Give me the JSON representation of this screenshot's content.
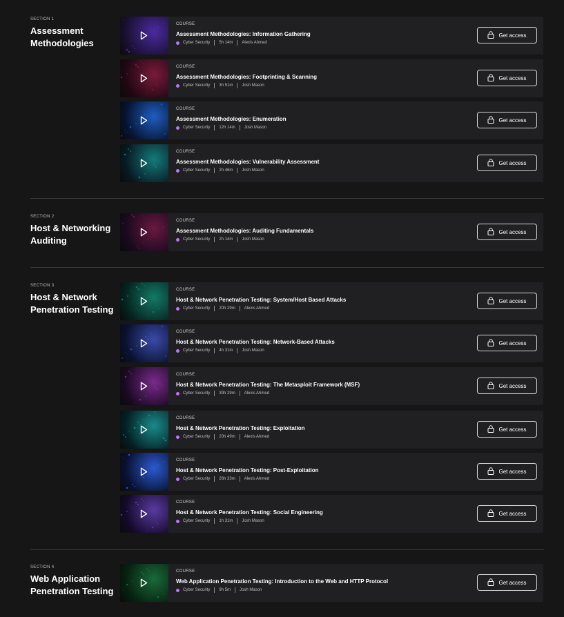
{
  "sections": [
    {
      "label": "SECTION 1",
      "title": "Assessment Methodologies",
      "courses": [
        {
          "kind": "COURSE",
          "title": "Assessment Methodologies: Information Gathering",
          "category": "Cyber Security",
          "duration": "5h 14m",
          "author": "Alexis Ahmed",
          "thumb": [
            "#1a1030",
            "#4a2aa0"
          ]
        },
        {
          "kind": "COURSE",
          "title": "Assessment Methodologies: Footprinting & Scanning",
          "category": "Cyber Security",
          "duration": "3h 51m",
          "author": "Josh Mason",
          "thumb": [
            "#200812",
            "#7a1a3a"
          ]
        },
        {
          "kind": "COURSE",
          "title": "Assessment Methodologies: Enumeration",
          "category": "Cyber Security",
          "duration": "12h 14m",
          "author": "Josh Mason",
          "thumb": [
            "#061430",
            "#1f5dc0"
          ]
        },
        {
          "kind": "COURSE",
          "title": "Assessment Methodologies: Vulnerability Assessment",
          "category": "Cyber Security",
          "duration": "2h 46m",
          "author": "Josh Mason",
          "thumb": [
            "#081a24",
            "#137a7a"
          ]
        }
      ]
    },
    {
      "label": "SECTION 2",
      "title": "Host & Networking Auditing",
      "courses": [
        {
          "kind": "COURSE",
          "title": "Assessment Methodologies: Auditing Fundamentals",
          "category": "Cyber Security",
          "duration": "2h 14m",
          "author": "Josh Mason",
          "thumb": [
            "#180a1e",
            "#6a1840"
          ]
        }
      ]
    },
    {
      "label": "SECTION 3",
      "title": "Host & Network Penetration Testing",
      "courses": [
        {
          "kind": "COURSE",
          "title": "Host & Network Penetration Testing: System/Host Based Attacks",
          "category": "Cyber Security",
          "duration": "20h 29m",
          "author": "Alexis Ahmed",
          "thumb": [
            "#062420",
            "#127a66"
          ]
        },
        {
          "kind": "COURSE",
          "title": "Host & Network Penetration Testing: Network-Based Attacks",
          "category": "Cyber Security",
          "duration": "4h 31m",
          "author": "Josh Mason",
          "thumb": [
            "#0a1230",
            "#3a4aa8"
          ]
        },
        {
          "kind": "COURSE",
          "title": "Host & Network Penetration Testing: The Metasploit Framework (MSF)",
          "category": "Cyber Security",
          "duration": "39h 29m",
          "author": "Alexis Ahmed",
          "thumb": [
            "#1a0a24",
            "#7a2a8a"
          ]
        },
        {
          "kind": "COURSE",
          "title": "Host & Network Penetration Testing: Exploitation",
          "category": "Cyber Security",
          "duration": "20h 49m",
          "author": "Alexis Ahmed",
          "thumb": [
            "#042024",
            "#1a8a8a"
          ]
        },
        {
          "kind": "COURSE",
          "title": "Host & Network Penetration Testing: Post-Exploitation",
          "category": "Cyber Security",
          "duration": "26h 33m",
          "author": "Alexis Ahmed",
          "thumb": [
            "#0a1030",
            "#2a5ad0"
          ]
        },
        {
          "kind": "COURSE",
          "title": "Host & Network Penetration Testing: Social Engineering",
          "category": "Cyber Security",
          "duration": "1h 31m",
          "author": "Josh Mason",
          "thumb": [
            "#140a2a",
            "#5a3aa0"
          ]
        }
      ]
    },
    {
      "label": "SECTION 4",
      "title": "Web Application Penetration Testing",
      "courses": [
        {
          "kind": "COURSE",
          "title": "Web Application Penetration Testing: Introduction to the Web and HTTP Protocol",
          "category": "Cyber Security",
          "duration": "9h 5m",
          "author": "Josh Mason",
          "thumb": [
            "#062010",
            "#1a6a3a"
          ]
        }
      ]
    }
  ],
  "button_label": "Get access",
  "accent_color": "#b679f2"
}
